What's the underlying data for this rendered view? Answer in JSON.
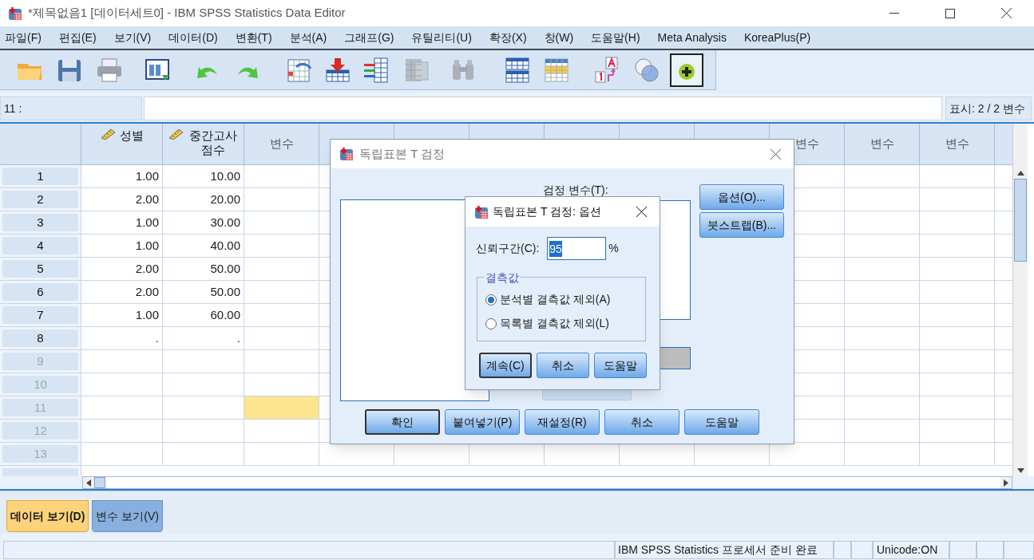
{
  "window": {
    "title": "*제목없음1 [데이터세트0] - IBM SPSS Statistics Data Editor"
  },
  "menu": [
    "파일(F)",
    "편집(E)",
    "보기(V)",
    "데이터(D)",
    "변환(T)",
    "분석(A)",
    "그래프(G)",
    "유틸리티(U)",
    "확장(X)",
    "창(W)",
    "도움말(H)",
    "Meta Analysis",
    "KoreaPlus(P)"
  ],
  "toolbar": [
    {
      "kind": "open",
      "disabled": false,
      "pressed": false
    },
    {
      "kind": "save",
      "disabled": false,
      "pressed": false
    },
    {
      "kind": "print",
      "disabled": false,
      "pressed": false
    },
    {
      "kind": "recall",
      "disabled": false,
      "pressed": false
    },
    {
      "kind": "undo",
      "disabled": false,
      "pressed": false
    },
    {
      "kind": "redo",
      "disabled": false,
      "pressed": false
    },
    {
      "kind": "goto",
      "disabled": false,
      "pressed": false
    },
    {
      "kind": "insert-cases",
      "disabled": false,
      "pressed": false
    },
    {
      "kind": "insert-variable",
      "disabled": false,
      "pressed": false
    },
    {
      "kind": "split",
      "disabled": true,
      "pressed": false
    },
    {
      "kind": "find",
      "disabled": true,
      "pressed": false
    },
    {
      "kind": "tables",
      "disabled": false,
      "pressed": false
    },
    {
      "kind": "select",
      "disabled": false,
      "pressed": false
    },
    {
      "kind": "labels",
      "disabled": false,
      "pressed": false
    },
    {
      "kind": "sets",
      "disabled": false,
      "pressed": false
    },
    {
      "kind": "extension",
      "disabled": false,
      "pressed": true
    }
  ],
  "cell_ref": "11 :",
  "visible_vars": "표시: 2 / 2 변수",
  "grid": {
    "columns": [
      {
        "label": "성별",
        "kind": "scale"
      },
      {
        "label": "중간고사 점수",
        "kind": "scale"
      },
      {
        "label": "변수",
        "kind": "empty"
      },
      {
        "kind": "empty"
      },
      {
        "kind": "empty"
      },
      {
        "kind": "empty"
      },
      {
        "kind": "empty"
      },
      {
        "kind": "empty"
      },
      {
        "kind": "empty"
      },
      {
        "label": "변수",
        "kind": "empty"
      },
      {
        "label": "변수",
        "kind": "empty"
      },
      {
        "label": "변수",
        "kind": "empty"
      },
      {
        "kind": "empty"
      }
    ],
    "rows": [
      {
        "number": "1",
        "cells": [
          {
            "value": "1.00",
            "selected": false
          },
          {
            "value": "10.00",
            "selected": false
          }
        ]
      },
      {
        "number": "2",
        "cells": [
          {
            "value": "2.00",
            "selected": false
          },
          {
            "value": "20.00",
            "selected": false
          }
        ]
      },
      {
        "number": "3",
        "cells": [
          {
            "value": "1.00",
            "selected": false
          },
          {
            "value": "30.00",
            "selected": false
          }
        ]
      },
      {
        "number": "4",
        "cells": [
          {
            "value": "1.00",
            "selected": false
          },
          {
            "value": "40.00",
            "selected": false
          }
        ]
      },
      {
        "number": "5",
        "cells": [
          {
            "value": "2.00",
            "selected": false
          },
          {
            "value": "50.00",
            "selected": false
          }
        ]
      },
      {
        "number": "6",
        "cells": [
          {
            "value": "2.00",
            "selected": false
          },
          {
            "value": "50.00",
            "selected": false
          }
        ]
      },
      {
        "number": "7",
        "cells": [
          {
            "value": "1.00",
            "selected": false
          },
          {
            "value": "60.00",
            "selected": false
          }
        ]
      },
      {
        "number": "8",
        "cells": [
          {
            "value": ".",
            "selected": false
          },
          {
            "value": ".",
            "selected": false
          }
        ]
      },
      {
        "number": "9"
      },
      {
        "number": "10"
      },
      {
        "number": "11",
        "cells": [
          {
            "selected": false
          },
          {
            "selected": false
          },
          {
            "selected": true
          }
        ]
      },
      {
        "number": "12"
      },
      {
        "number": "13"
      }
    ]
  },
  "dialog": {
    "title": "독립표본 T 검정",
    "test_variables_label": "검정 변수(T):",
    "side_buttons": [
      "옵션(O)...",
      "붓스트랩(B)..."
    ],
    "buttons": [
      {
        "label": "확인",
        "default": true
      },
      {
        "label": "붙여넣기(P)",
        "default": false
      },
      {
        "label": "재설정(R)",
        "default": false
      },
      {
        "label": "취소",
        "default": false
      },
      {
        "label": "도움말",
        "default": false
      }
    ]
  },
  "options_dialog": {
    "title": "독립표본 T 검정: 옵션",
    "confidence_label": "신뢰구간(C):",
    "confidence_value": "95",
    "percent": "%",
    "missing_group": {
      "legend": "결측값",
      "options": [
        {
          "label": "분석별 결측값 제외(A)",
          "selected": true
        },
        {
          "label": "목록별 결측값 제외(L)",
          "selected": false
        }
      ]
    },
    "buttons": [
      {
        "label": "계속(C)",
        "default": true
      },
      {
        "label": "취소",
        "default": false
      },
      {
        "label": "도움말",
        "default": false
      }
    ]
  },
  "tabs": [
    {
      "label": "데이터 보기(D)",
      "selected": true
    },
    {
      "label": "변수 보기(V)",
      "selected": false
    }
  ],
  "status_bar": {
    "message": "IBM SPSS Statistics 프로세서 준비 완료",
    "encoding": "Unicode:ON"
  }
}
